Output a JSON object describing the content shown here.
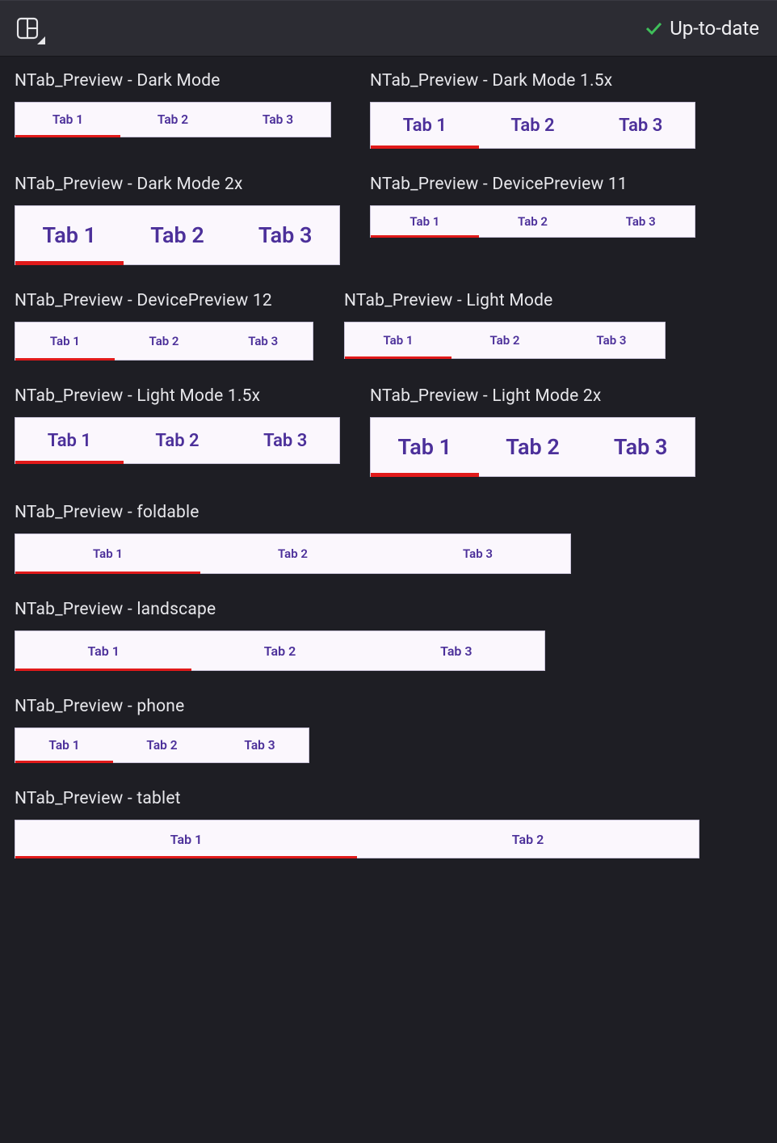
{
  "header": {
    "status_label": "Up-to-date"
  },
  "tabs3": {
    "t1": "Tab 1",
    "t2": "Tab 2",
    "t3": "Tab 3"
  },
  "tabs2": {
    "t1": "Tab 1",
    "t2": "Tab 2"
  },
  "previews": {
    "dark": {
      "title": "NTab_Preview - Dark Mode"
    },
    "dark15": {
      "title": "NTab_Preview - Dark Mode 1.5x"
    },
    "dark2": {
      "title": "NTab_Preview - Dark Mode 2x"
    },
    "dp11": {
      "title": "NTab_Preview - DevicePreview 11"
    },
    "dp12": {
      "title": "NTab_Preview - DevicePreview 12"
    },
    "light": {
      "title": "NTab_Preview - Light Mode"
    },
    "light15": {
      "title": "NTab_Preview - Light Mode 1.5x"
    },
    "light2": {
      "title": "NTab_Preview - Light Mode 2x"
    },
    "foldable": {
      "title": "NTab_Preview - foldable"
    },
    "landscape": {
      "title": "NTab_Preview - landscape"
    },
    "phone": {
      "title": "NTab_Preview - phone"
    },
    "tablet": {
      "title": "NTab_Preview - tablet"
    }
  }
}
